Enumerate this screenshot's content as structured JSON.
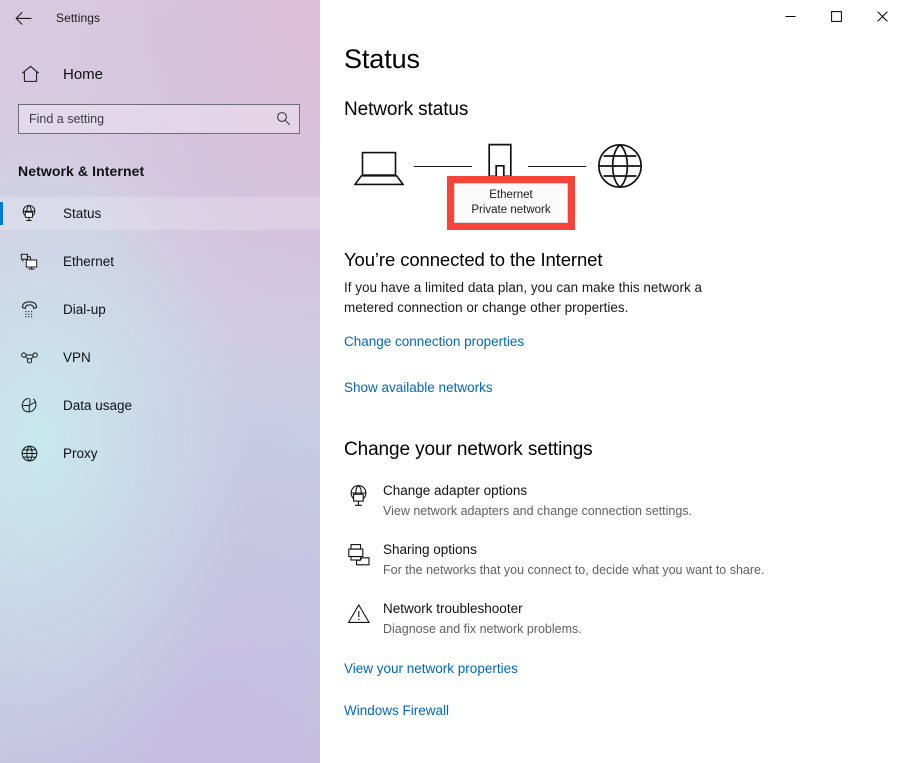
{
  "window": {
    "app_title": "Settings",
    "back_icon": "back-arrow-icon",
    "controls": {
      "minimize": "─",
      "maximize": "□",
      "close": "✕"
    }
  },
  "sidebar": {
    "home_label": "Home",
    "home_icon": "home-icon",
    "search": {
      "placeholder": "Find a setting",
      "value": "",
      "icon": "search-icon"
    },
    "category": "Network & Internet",
    "items": [
      {
        "label": "Status",
        "icon": "network-status-icon",
        "selected": true
      },
      {
        "label": "Ethernet",
        "icon": "ethernet-icon",
        "selected": false
      },
      {
        "label": "Dial-up",
        "icon": "dialup-phone-icon",
        "selected": false
      },
      {
        "label": "VPN",
        "icon": "vpn-icon",
        "selected": false
      },
      {
        "label": "Data usage",
        "icon": "pie-chart-icon",
        "selected": false
      },
      {
        "label": "Proxy",
        "icon": "globe-icon",
        "selected": false
      }
    ]
  },
  "main": {
    "page_title": "Status",
    "network_status_heading": "Network status",
    "diagram": {
      "device_icon": "laptop-icon",
      "adapter_icon": "ethernet-port-icon",
      "internet_icon": "globe-icon",
      "callout": {
        "name": "Ethernet",
        "type": "Private network",
        "highlight_color": "#f84339"
      }
    },
    "connection_status": "You’re connected to the Internet",
    "connection_description": "If you have a limited data plan, you can make this network a metered connection or change other properties.",
    "links": {
      "change_connection_properties": "Change connection properties",
      "show_available_networks": "Show available networks",
      "view_network_properties": "View your network properties",
      "windows_firewall": "Windows Firewall"
    },
    "settings_heading": "Change your network settings",
    "options": [
      {
        "title": "Change adapter options",
        "subtitle": "View network adapters and change connection settings.",
        "icon": "adapter-globe-icon"
      },
      {
        "title": "Sharing options",
        "subtitle": "For the networks that you connect to, decide what you want to share.",
        "icon": "sharing-printer-icon"
      },
      {
        "title": "Network troubleshooter",
        "subtitle": "Diagnose and fix network problems.",
        "icon": "warning-triangle-icon"
      }
    ]
  },
  "colors": {
    "accent": "#0078d4",
    "link": "#0067c0",
    "highlight": "#f84339"
  }
}
